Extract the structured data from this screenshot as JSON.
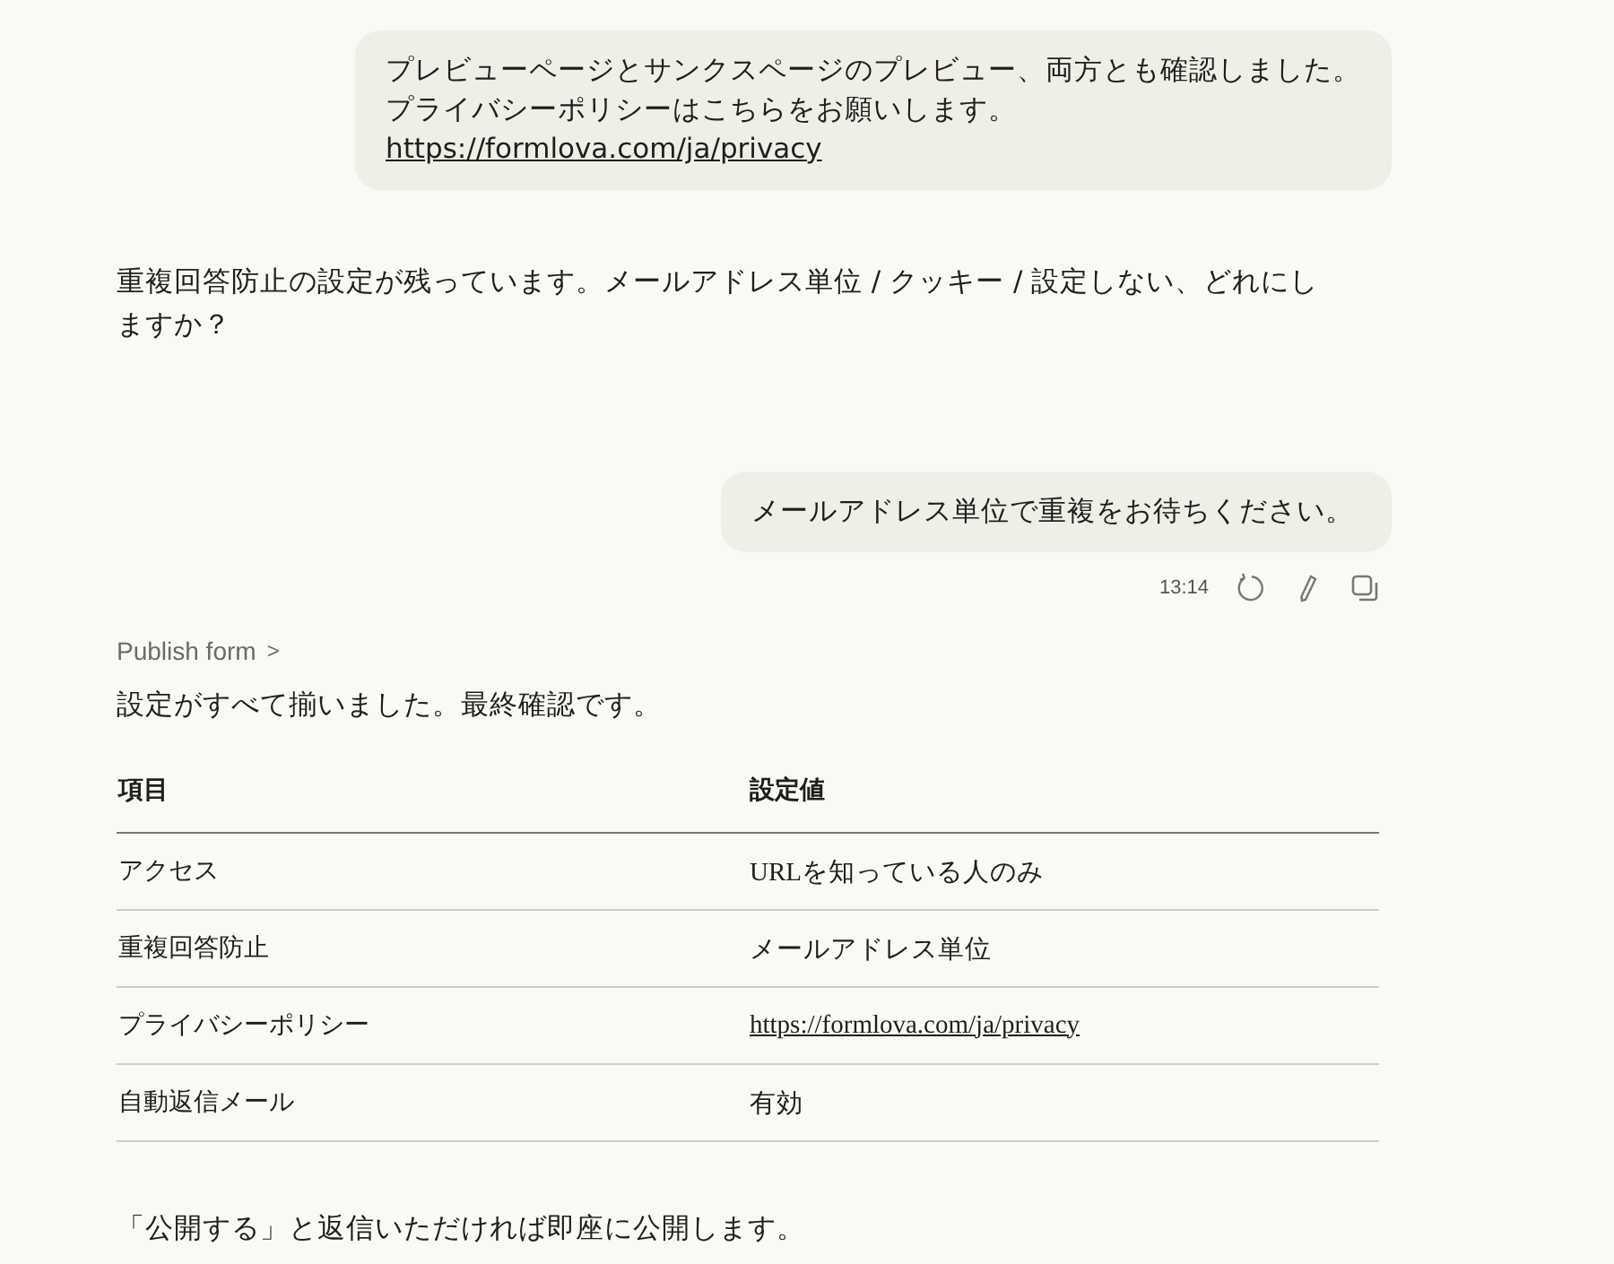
{
  "messages": [
    {
      "kind": "user",
      "lines": [
        "プレビューページとサンクスページのプレビュー、両方とも確認しました。",
        "プライバシーポリシーはこちらをお願いします。"
      ],
      "link": "https://formlova.com/ja/privacy"
    },
    {
      "kind": "assistant",
      "text": "重複回答防止の設定が残っています。メールアドレス単位 / クッキー / 設定しない、どれにしますか？"
    },
    {
      "kind": "user",
      "lines": [
        "メールアドレス単位で重複をお待ちください。"
      ],
      "time": "13:14"
    },
    {
      "kind": "tool",
      "tool_label": "Publish form",
      "tool_chevron": ">",
      "intro": "設定がすべて揃いました。最終確認です。",
      "table": {
        "columns": [
          "項目",
          "設定値"
        ],
        "rows": [
          {
            "kind": "text",
            "item": "アクセス",
            "value": "URLを知っている人のみ"
          },
          {
            "kind": "text",
            "item": "重複回答防止",
            "value": "メールアドレス単位"
          },
          {
            "kind": "link",
            "item": "プライバシーポリシー",
            "value": "https://formlova.com/ja/privacy"
          },
          {
            "kind": "text",
            "item": "自動返信メール",
            "value": "有効"
          }
        ]
      },
      "outro": "「公開する」と返信いただければ即座に公開します。"
    }
  ]
}
